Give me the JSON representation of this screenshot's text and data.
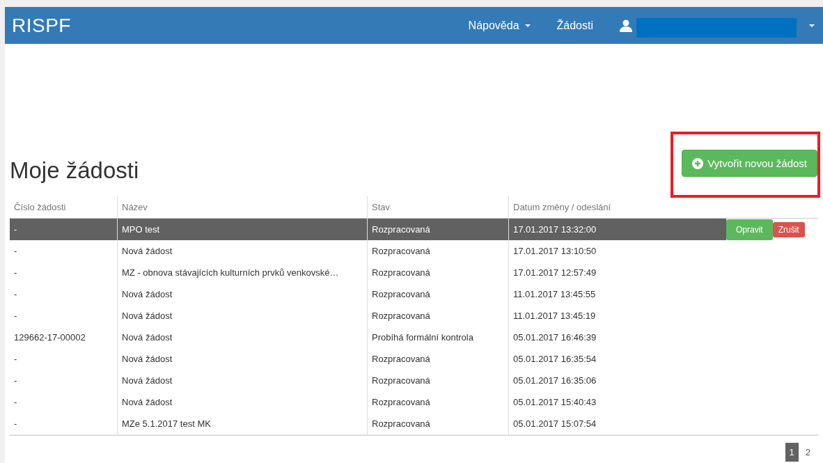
{
  "navbar": {
    "brand": "RISPF",
    "links": [
      {
        "label": "Nápověda",
        "dropdown": true
      },
      {
        "label": "Žádosti",
        "dropdown": false
      }
    ],
    "user_dropdown": true
  },
  "page": {
    "title": "Moje žádosti",
    "create_button": "Vytvořit novou žádost"
  },
  "table": {
    "columns": [
      "Číslo žádosti",
      "Název",
      "Stav",
      "Datum změny / odeslání"
    ],
    "row_actions": [
      "Opravit",
      "Zrušit"
    ],
    "rows": [
      {
        "number": "-",
        "name": "MPO test",
        "status": "Rozpracovaná",
        "date": "17.01.2017 13:32:00",
        "selected": true
      },
      {
        "number": "-",
        "name": "Nová žádost",
        "status": "Rozpracovaná",
        "date": "17.01.2017 13:10:50",
        "selected": false
      },
      {
        "number": "-",
        "name": "MZ - obnova stávajících kulturních prvků venkovské…",
        "status": "Rozpracovaná",
        "date": "17.01.2017 12:57:49",
        "selected": false
      },
      {
        "number": "-",
        "name": "Nová žádost",
        "status": "Rozpracovaná",
        "date": "11.01.2017 13:45:55",
        "selected": false
      },
      {
        "number": "-",
        "name": "Nová žádost",
        "status": "Rozpracovaná",
        "date": "11.01.2017 13:45:19",
        "selected": false
      },
      {
        "number": "129662-17-00002",
        "name": "Nová žádost",
        "status": "Probíhá formální kontrola",
        "date": "05.01.2017 16:46:39",
        "selected": false
      },
      {
        "number": "-",
        "name": "Nová žádost",
        "status": "Rozpracovaná",
        "date": "05.01.2017 16:35:54",
        "selected": false
      },
      {
        "number": "-",
        "name": "Nová žádost",
        "status": "Rozpracovaná",
        "date": "05.01.2017 16:35:06",
        "selected": false
      },
      {
        "number": "-",
        "name": "Nová žádost",
        "status": "Rozpracovaná",
        "date": "05.01.2017 15:40:43",
        "selected": false
      },
      {
        "number": "-",
        "name": "MZe 5.1.2017 test MK",
        "status": "Rozpracovaná",
        "date": "05.01.2017 15:07:54",
        "selected": false
      }
    ]
  },
  "pagination": [
    {
      "label": "1",
      "selected": true
    },
    {
      "label": "2",
      "selected": false
    }
  ]
}
